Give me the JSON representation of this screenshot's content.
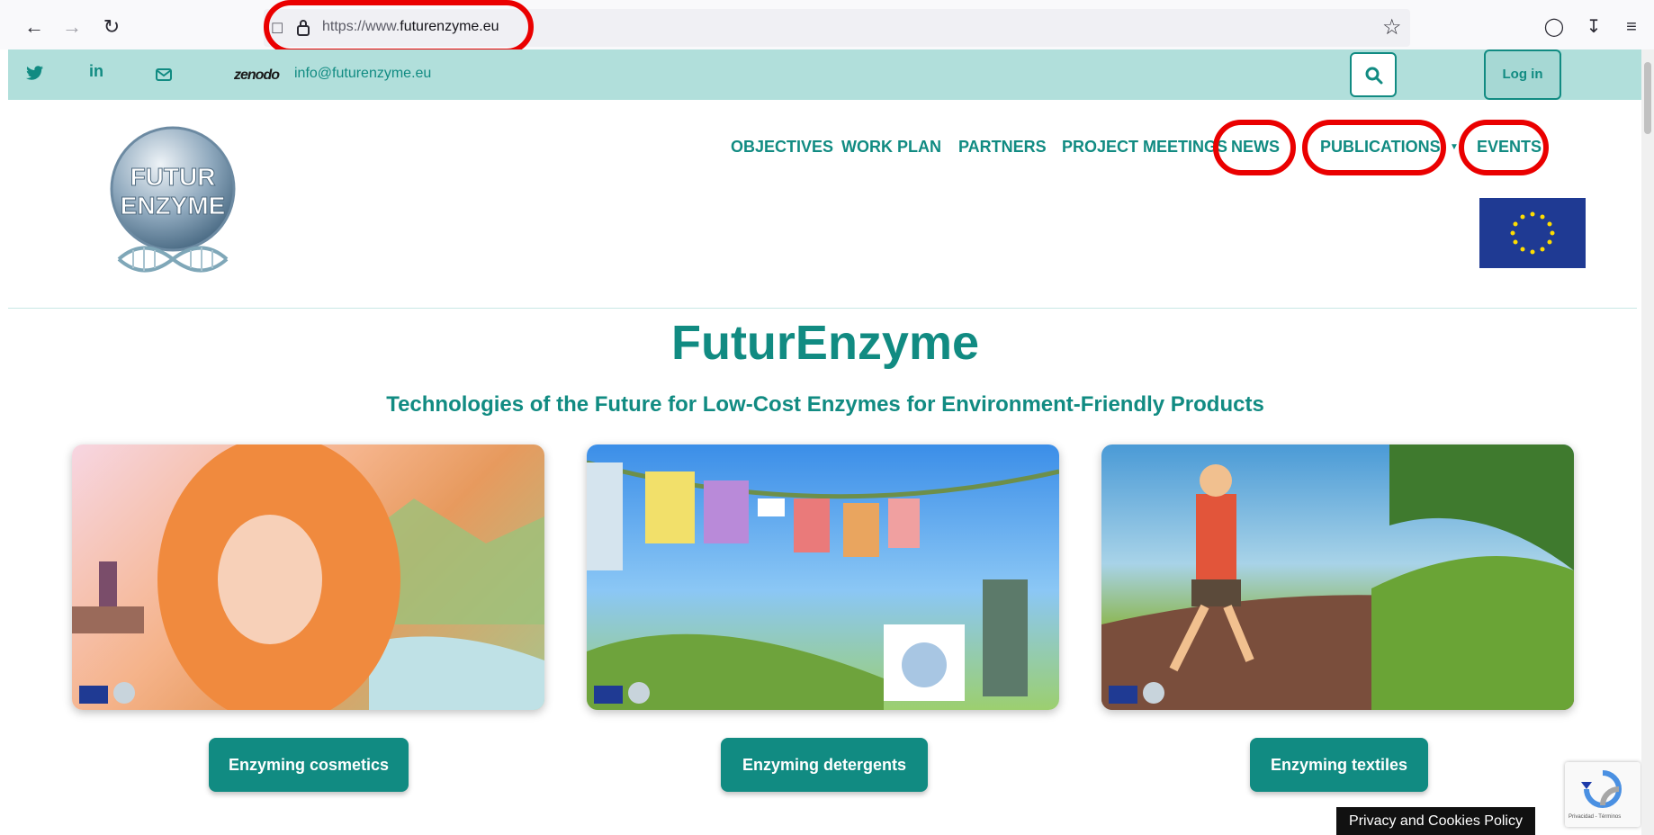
{
  "browser": {
    "url_prefix": "https://www.",
    "url_domain": "futurenzyme.eu"
  },
  "topbar": {
    "zenodo_label": "zenodo",
    "email": "info@futurenzyme.eu",
    "login_label": "Log in"
  },
  "nav": {
    "items": [
      {
        "label": "OBJECTIVES"
      },
      {
        "label": "WORK PLAN"
      },
      {
        "label": "PARTNERS"
      },
      {
        "label": "PROJECT MEETINGS"
      },
      {
        "label": "NEWS"
      },
      {
        "label": "PUBLICATIONS"
      },
      {
        "label": "EVENTS"
      }
    ]
  },
  "logo": {
    "line1": "FUTUR",
    "line2": "ENZYME"
  },
  "main": {
    "title": "FuturEnzyme",
    "subtitle": "Technologies of the Future for Low-Cost Enzymes for Environment-Friendly Products",
    "cards": [
      {
        "button_label": "Enzyming cosmetics"
      },
      {
        "button_label": "Enzyming detergents"
      },
      {
        "button_label": "Enzyming textiles"
      }
    ]
  },
  "footer": {
    "cookie_label": "Privacy and Cookies Policy",
    "recaptcha_label": "Privacidad - Términos"
  },
  "colors": {
    "brand_teal": "#118b82",
    "topbar_bg": "#b1dfdb",
    "highlight_red": "#ea0000"
  }
}
